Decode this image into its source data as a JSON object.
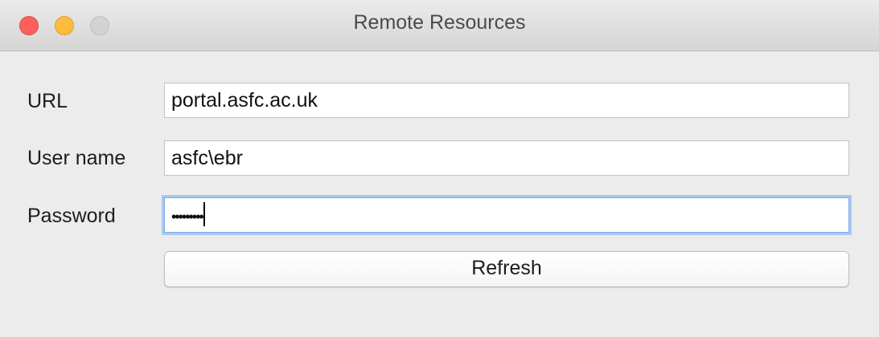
{
  "window": {
    "title": "Remote Resources"
  },
  "form": {
    "url_label": "URL",
    "url_value": "portal.asfc.ac.uk",
    "username_label": "User name",
    "username_value": "asfc\\ebr",
    "password_label": "Password",
    "password_masked": "•••••••••",
    "refresh_label": "Refresh"
  },
  "colors": {
    "close": "#fc605c",
    "minimize": "#fdbc40",
    "zoom_disabled": "#d3d3d3",
    "focus_ring": "#a9c8f2"
  }
}
